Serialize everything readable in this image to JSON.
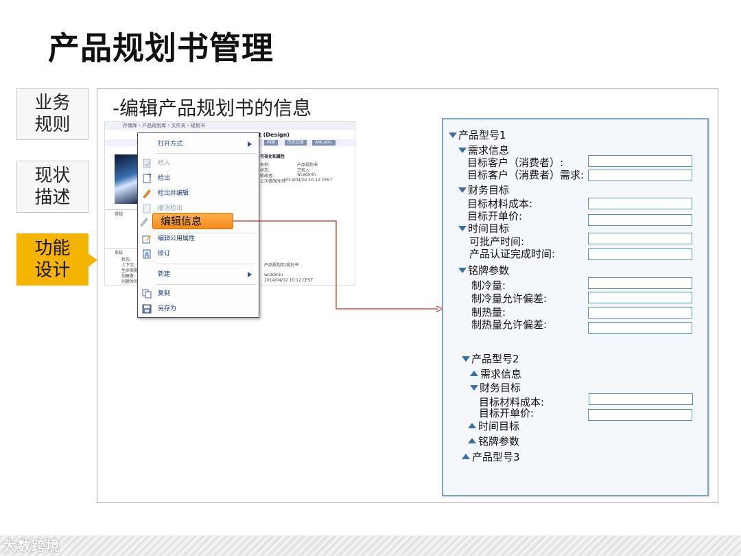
{
  "slide": {
    "title": "产品规划书管理",
    "heading": "-编辑产品规划书的信息"
  },
  "side_tabs": [
    {
      "line1": "业务",
      "line2": "规则",
      "active": false
    },
    {
      "line1": "现状",
      "line2": "描述",
      "active": false
    },
    {
      "line1": "功能",
      "line2": "设计",
      "active": true
    }
  ],
  "screenshot": {
    "breadcrumb": "存储库 › 产品规划库 › 文件夹 › 规划书",
    "design_title": "t (Design)",
    "section_label": "可视化和属性",
    "props": [
      "名称:",
      "状态:",
      "修改者:",
      "上次修改时间:"
    ],
    "prop_values": [
      "产品规划书",
      "已检入",
      "wcadmin",
      "2014/04/02 10:12 CEST"
    ],
    "lower_values": [
      "产品规划库/规划书",
      "wcadmin",
      "2014/04/02 10:12 CEST"
    ],
    "tabs": [
      "内容",
      "历史记录",
      "AML/AVL"
    ],
    "left_labels": [
      "常规",
      "系统",
      "状态:",
      "上下文:",
      "生命周期:",
      "创建者:",
      "创建时间:"
    ]
  },
  "context_menu": {
    "items": [
      {
        "label": "打开方式",
        "disabled": false,
        "submenu": true,
        "icon": "none"
      },
      {
        "label": "检入",
        "disabled": true,
        "submenu": false,
        "icon": "check-in-icon"
      },
      {
        "label": "检出",
        "disabled": false,
        "submenu": false,
        "icon": "check-out-icon"
      },
      {
        "label": "检出并编辑",
        "disabled": false,
        "submenu": false,
        "icon": "pencil-icon"
      },
      {
        "label": "撤消检出",
        "disabled": true,
        "submenu": false,
        "icon": "undo-checkout-icon"
      },
      {
        "label": "编辑信息",
        "disabled": false,
        "submenu": false,
        "icon": "edit-icon"
      },
      {
        "label": "编辑公用属性",
        "disabled": false,
        "submenu": false,
        "icon": "edit-attr-icon"
      },
      {
        "label": "修订",
        "disabled": false,
        "submenu": false,
        "icon": "revise-icon"
      },
      {
        "label": "新建",
        "disabled": false,
        "submenu": true,
        "icon": "none"
      },
      {
        "label": "复制",
        "disabled": false,
        "submenu": false,
        "icon": "copy-icon"
      },
      {
        "label": "另存为",
        "disabled": false,
        "submenu": false,
        "icon": "save-as-icon"
      }
    ],
    "highlighted": "编辑信息"
  },
  "form": {
    "model1": "产品型号1",
    "demand": "需求信息",
    "target_customer": "目标客户（消费者）:",
    "target_customer_demand": "目标客户（消费者）需求:",
    "finance": "财务目标",
    "material_cost": "目标材料成本:",
    "unit_price": "目标开单价:",
    "time": "时间目标",
    "approve_time": "可批产时间:",
    "cert_time": "产品认证完成时间:",
    "nameplate": "铭牌参数",
    "cooling": "制冷量:",
    "cooling_tol": "制冷量允许偏差:",
    "heating": "制热量:",
    "heating_tol": "制热量允许偏差:",
    "model2": "产品型号2",
    "demand2": "需求信息",
    "finance2": "财务目标",
    "material_cost2": "目标材料成本:",
    "unit_price2": "目标开单价:",
    "time2": "时间目标",
    "nameplate2": "铭牌参数",
    "model3": "产品型号3"
  },
  "colors": {
    "accent": "#f5b400",
    "highlight": "#f08a1c",
    "panel_border": "#7fa4c7",
    "connector": "#d9261c"
  },
  "watermark": "大数跨境"
}
